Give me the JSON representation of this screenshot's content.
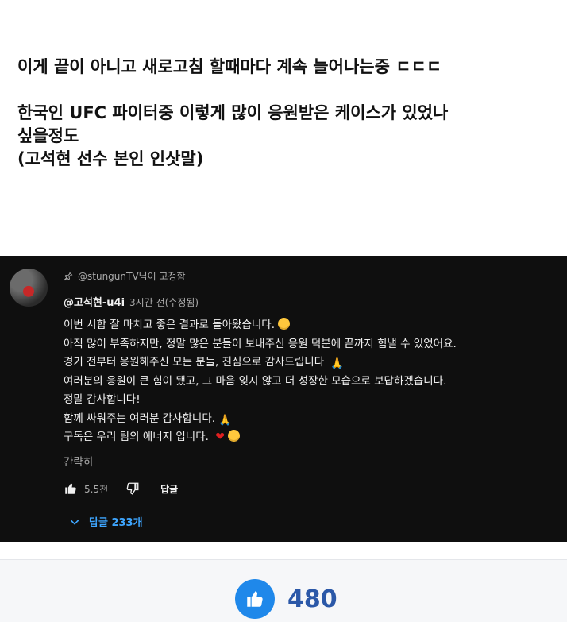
{
  "post": {
    "lines": [
      "이게 끝이 아니고 새로고침 할때마다 계속 늘어나는중 ㄷㄷㄷ",
      "한국인 UFC 파이터중 이렇게 많이 응원받은 케이스가 있었나",
      "싶을정도",
      "(고석현 선수 본인 인삿말)"
    ]
  },
  "comment": {
    "pinned_text": "@stungunTV님이 고정함",
    "author": "@고석현-u4i",
    "time": "3시간 전(수정됨)",
    "lines": [
      "이번 시합 잘 마치고 좋은 결과로 돌아왔습니다.",
      "아직 많이 부족하지만, 정말 많은 분들이 보내주신 응원 덕분에 끝까지 힘낼 수 있었어요.",
      "경기 전부터 응원해주신 모든 분들, 진심으로 감사드립니다",
      "여러분의 응원이 큰 힘이 됐고, 그 마음 잊지 않고 더 성장한 모습으로 보답하겠습니다.",
      "정말 감사합니다!",
      "함께 싸워주는 여러분 감사합니다.",
      "구독은 우리 팀의 에너지 입니다."
    ],
    "collapse_label": "간략히",
    "like_count": "5.5천",
    "reply_label": "답글",
    "replies_label": "답글 233개"
  },
  "vote": {
    "count": "480",
    "accent": "#1f88ea"
  },
  "colors": {
    "card_bg": "#0f0f0f",
    "link_blue": "#3ea6ff",
    "heart": "#e02020"
  }
}
